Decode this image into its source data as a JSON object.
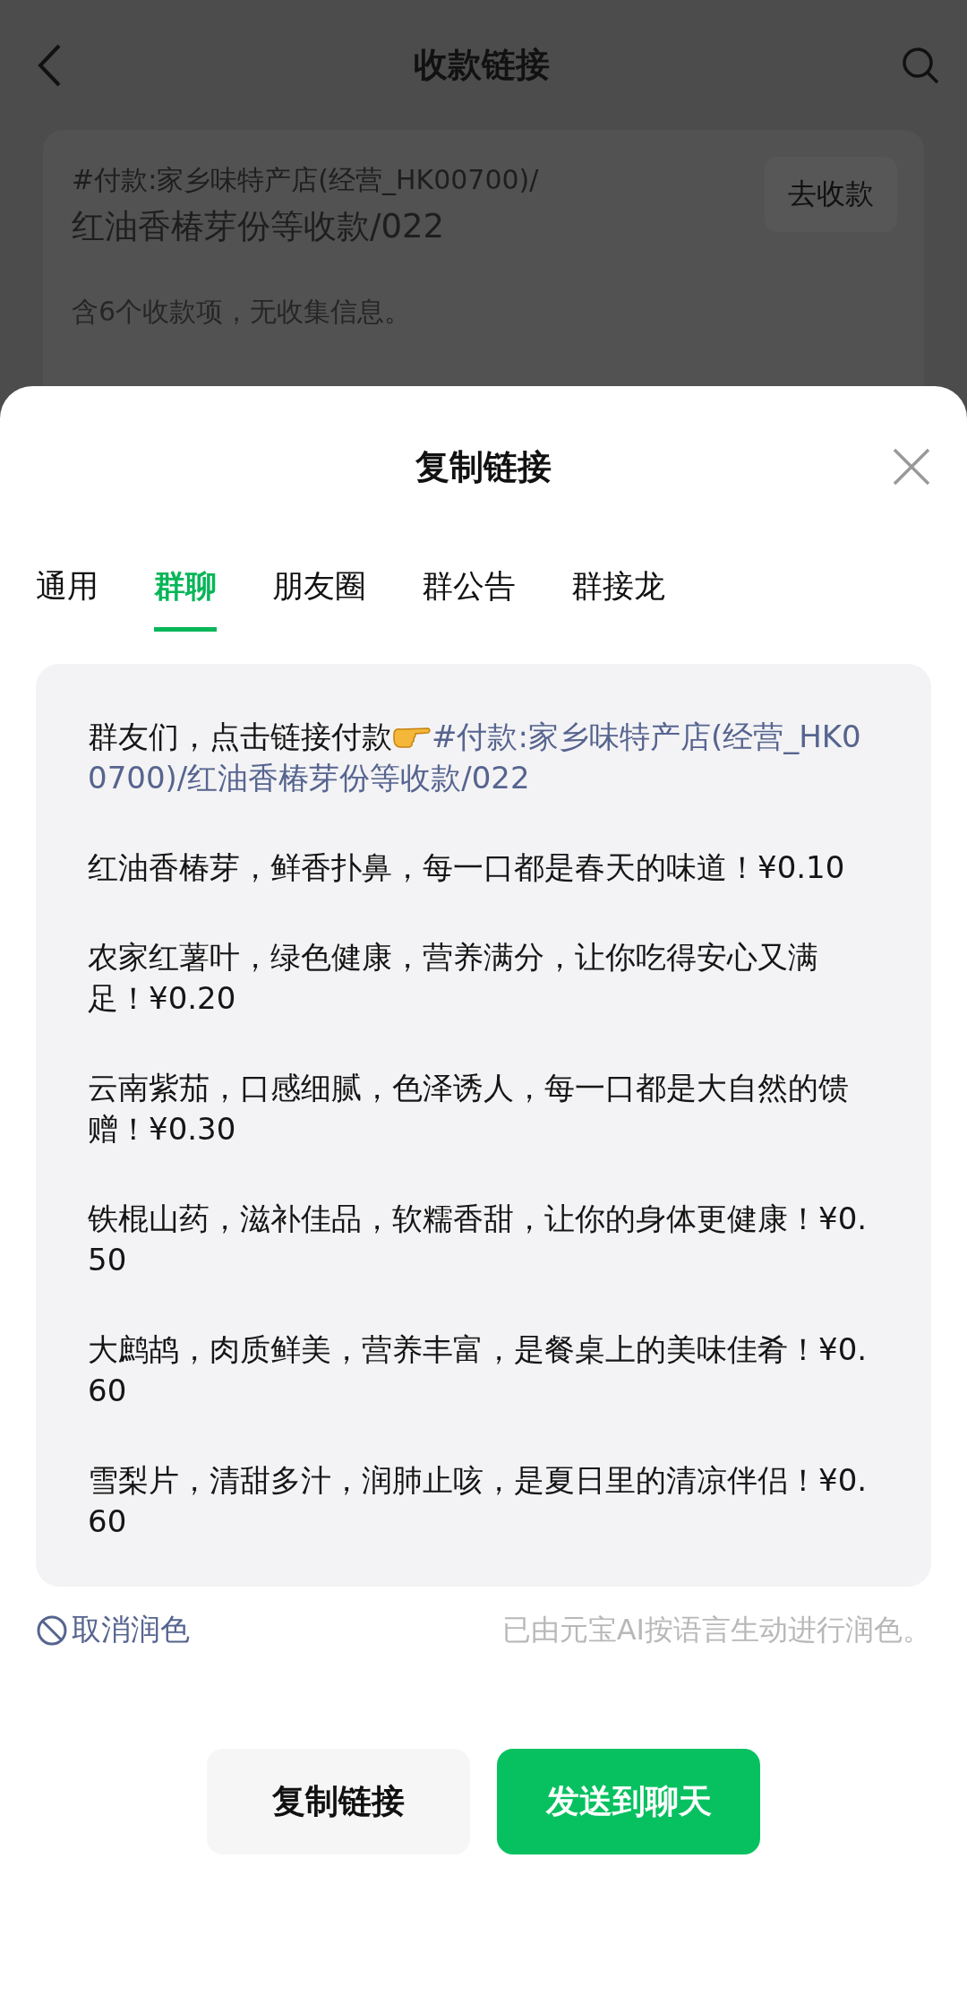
{
  "nav": {
    "title": "收款链接"
  },
  "card": {
    "title_prefix": "#付款:家乡味特产店(经营_HK00700)/",
    "title": "红油香椿芽份等收款/022",
    "action": "去收款",
    "summary": "含6个收款项，无收集信息。"
  },
  "sheet": {
    "title": "复制链接",
    "tabs": [
      {
        "label": "通用",
        "selected": false
      },
      {
        "label": "群聊",
        "selected": true
      },
      {
        "label": "朋友圈",
        "selected": false
      },
      {
        "label": "群公告",
        "selected": false
      },
      {
        "label": "群接龙",
        "selected": false
      }
    ],
    "message": {
      "intro": "群友们，点击链接付款",
      "link": "#付款:家乡味特产店(经营_HK00700)/红油香椿芽份等收款/022",
      "items": [
        "红油香椿芽，鲜香扑鼻，每一口都是春天的味道！¥0.10",
        "农家红薯叶，绿色健康，营养满分，让你吃得安心又满足！¥0.20",
        "云南紫茄，口感细腻，色泽诱人，每一口都是大自然的馈赠！¥0.30",
        "铁棍山药，滋补佳品，软糯香甜，让你的身体更健康！¥0.50",
        "大鹧鸪，肉质鲜美，营养丰富，是餐桌上的美味佳肴！¥0.60",
        "雪梨片，清甜多汁，润肺止咳，是夏日里的清凉伴侣！¥0.60"
      ]
    },
    "cancel_polish": "取消润色",
    "polish_note": "已由元宝AI按语言生动进行润色。",
    "buttons": [
      {
        "label": "复制链接",
        "kind": "secondary"
      },
      {
        "label": "发送到聊天",
        "kind": "primary"
      }
    ]
  }
}
